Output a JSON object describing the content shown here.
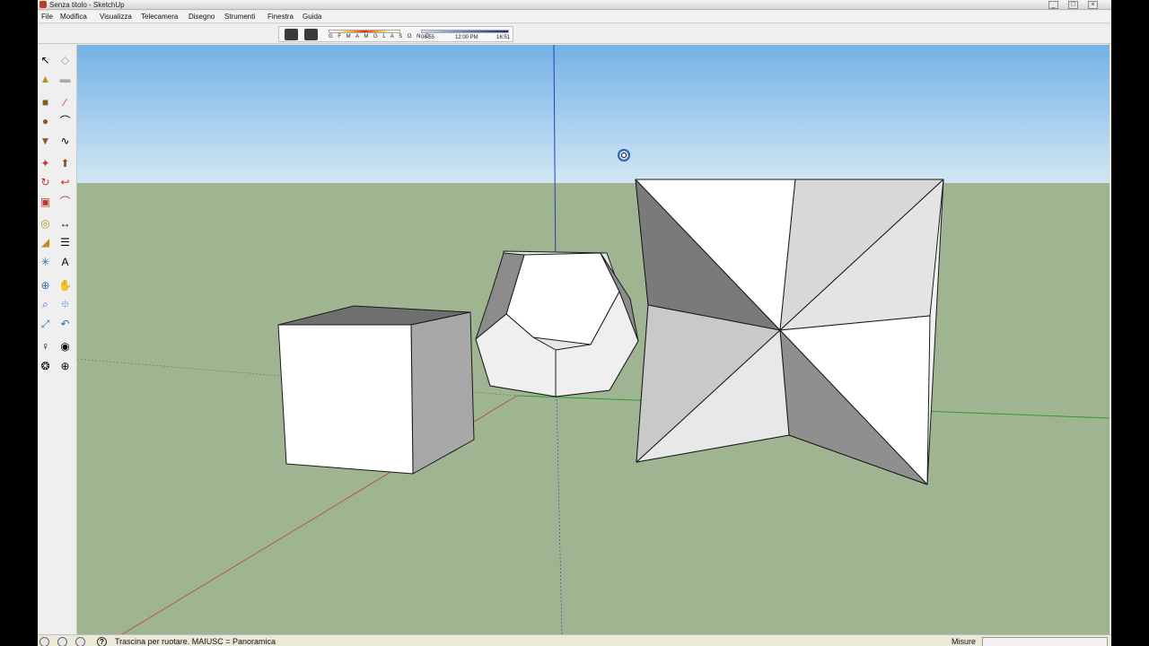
{
  "window": {
    "title": "Senza titolo - SketchUp"
  },
  "menu": [
    "File",
    "Modifica",
    "Visualizza",
    "Telecamera",
    "Disegno",
    "Strumenti",
    "Finestra",
    "Guida"
  ],
  "shadows": {
    "months": "G F M A M G L A S O N D",
    "time_start": "06:55",
    "time_mid": "12:00 PM",
    "time_end": "16:51"
  },
  "status": {
    "hint": "Trascina per ruotare.  MAIUSC = Panoramica",
    "measure_label": "Misure",
    "measure_value": ""
  },
  "colors": {
    "sky_top": "#74b2e6",
    "sky_bottom": "#d2e6f3",
    "ground": "#9fb591",
    "axis_red": "#b35a3a",
    "axis_green": "#2e9a2e",
    "axis_blue": "#2b3fb0"
  },
  "tools": [
    "select-icon",
    "make-component-icon",
    "paint-bucket-icon",
    "eraser-icon",
    "rectangle-icon",
    "line-icon",
    "circle-icon",
    "arc-icon",
    "polygon-icon",
    "freehand-icon",
    "move-icon",
    "push-pull-icon",
    "rotate-icon",
    "follow-me-icon",
    "scale-icon",
    "offset-icon",
    "tape-measure-icon",
    "dimension-icon",
    "protractor-icon",
    "text-icon",
    "axes-icon",
    "3d-text-icon",
    "orbit-icon",
    "pan-icon",
    "zoom-icon",
    "zoom-window-icon",
    "zoom-extents-icon",
    "previous-view-icon",
    "position-camera-icon",
    "look-around-icon",
    "walk-icon",
    "section-plane-icon"
  ]
}
